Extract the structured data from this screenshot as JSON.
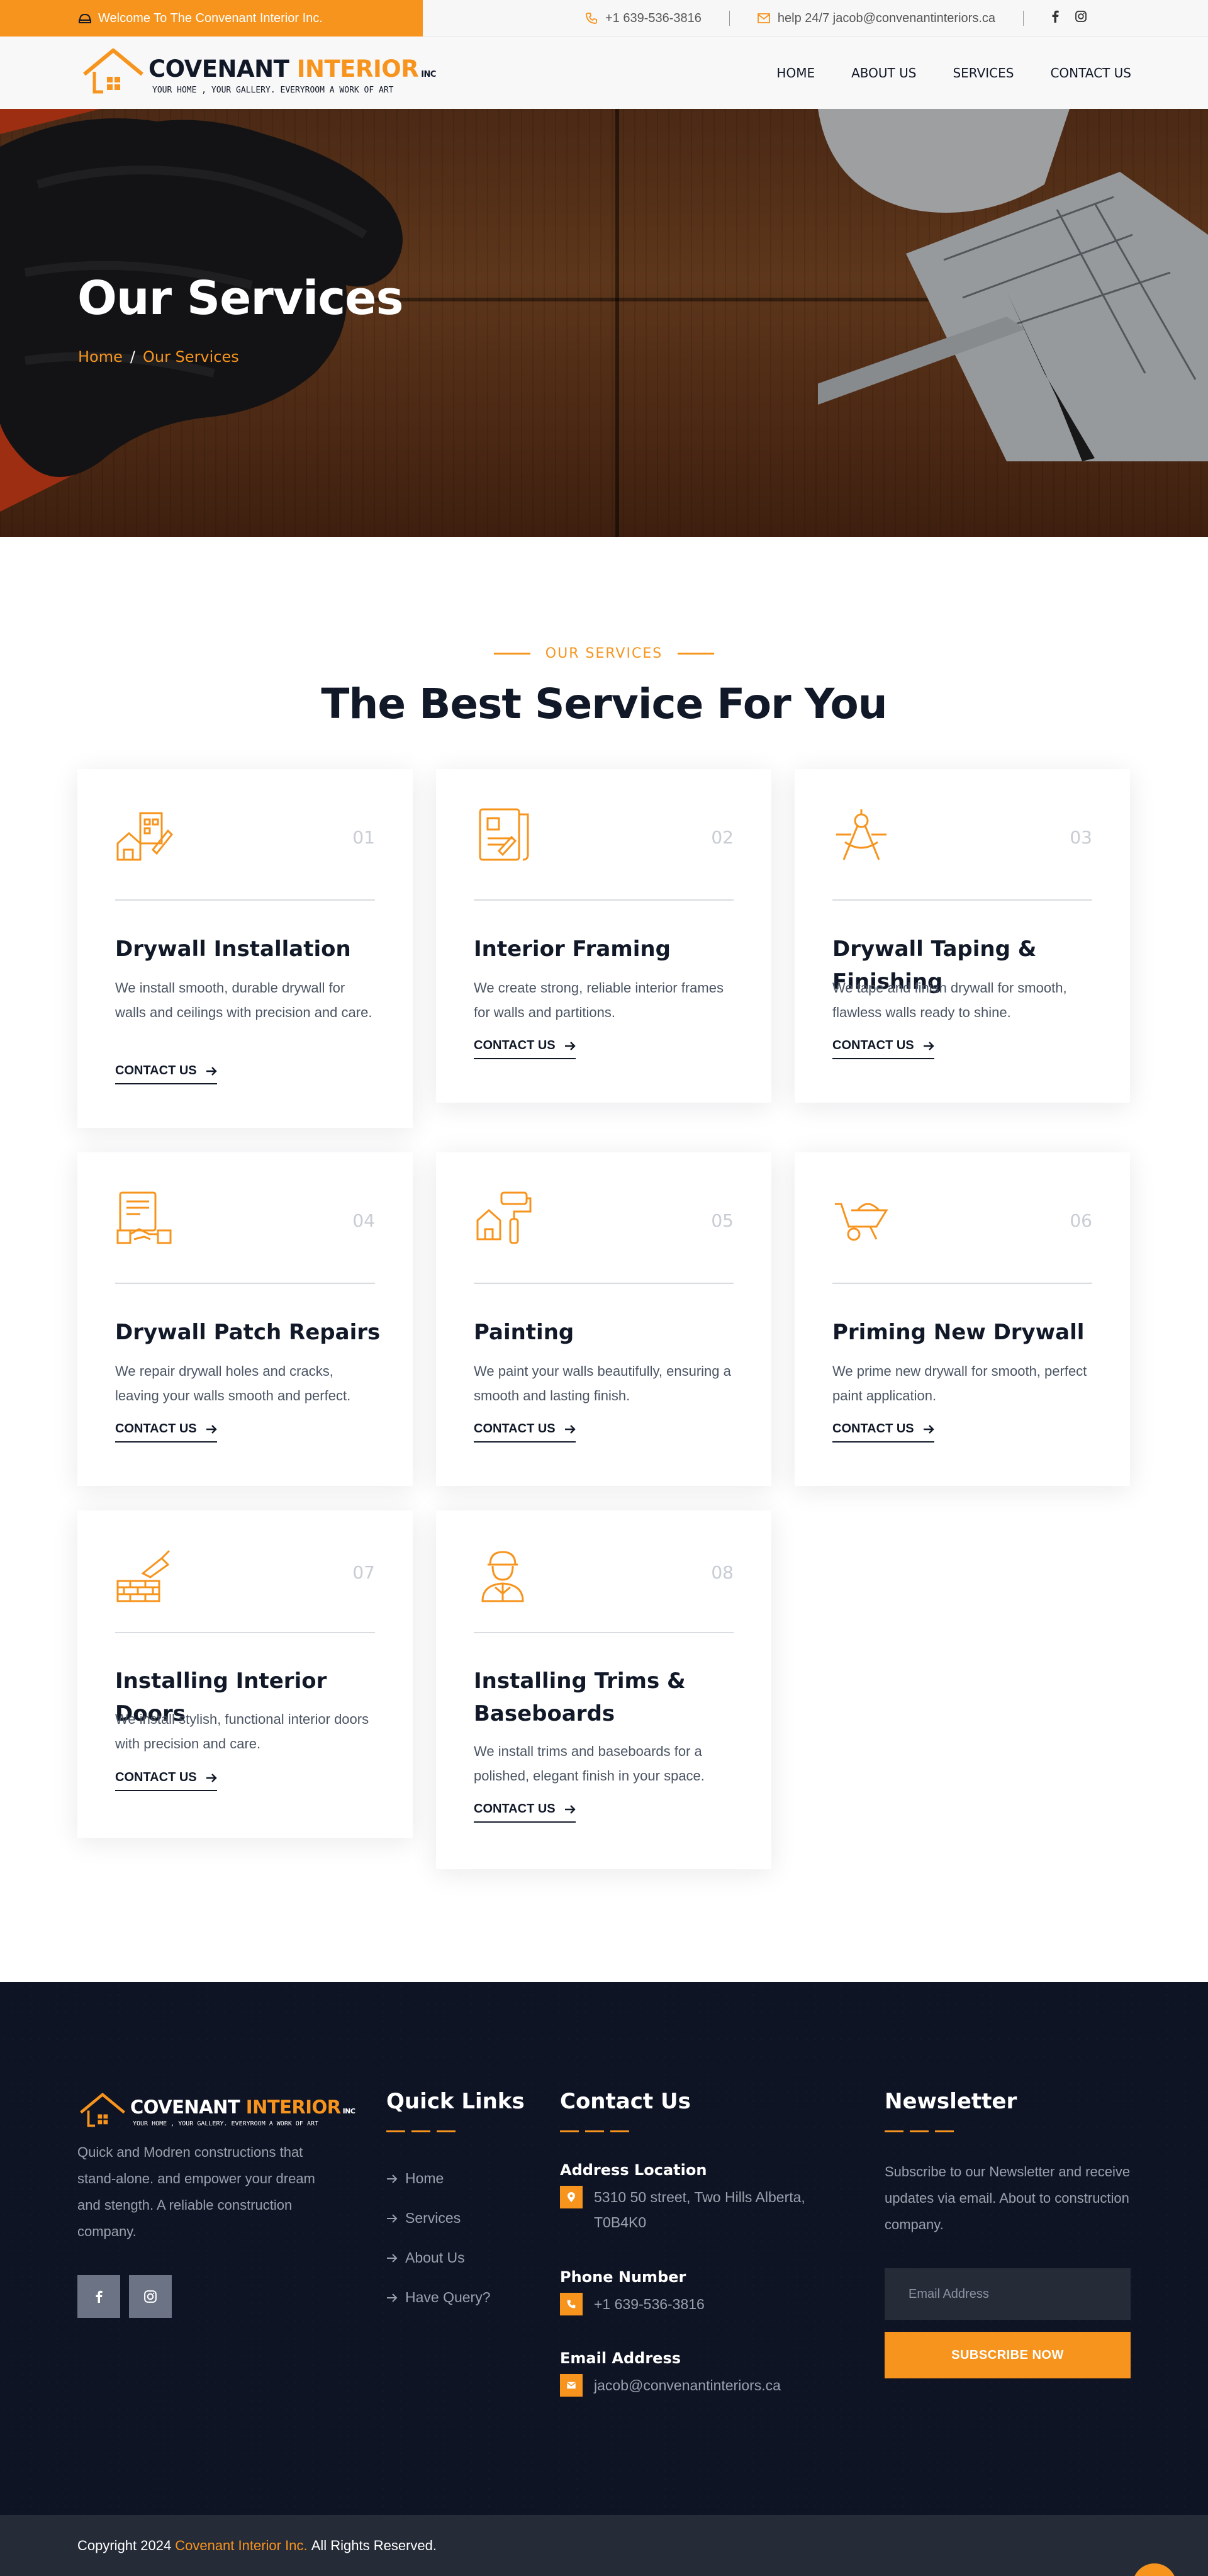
{
  "colors": {
    "accent": "#f7941d",
    "dark": "#111827",
    "footer_bg": "#0f1424",
    "copyright_bg": "#262b38"
  },
  "topbar": {
    "welcome": "Welcome To The Convenant Interior Inc.",
    "phone": "+1 639-536-3816",
    "email": "help 24/7 jacob@convenantinteriors.ca",
    "social_icons": [
      "facebook-icon",
      "instagram-icon"
    ]
  },
  "header": {
    "logo": {
      "name_part1": "COVENANT",
      "name_part2": "INTERIOR",
      "suffix": "INC",
      "tagline": "YOUR HOME , YOUR GALLERY. EVERYROOM A WORK OF ART"
    },
    "nav": [
      "HOME",
      "ABOUT US",
      "SERVICES",
      "CONTACT US"
    ]
  },
  "hero": {
    "title": "Our Services",
    "breadcrumb": {
      "home": "Home",
      "separator": "/",
      "current": "Our Services"
    }
  },
  "services": {
    "tagline": "OUR SERVICES",
    "heading": "The Best Service For You",
    "items": [
      {
        "number": "01",
        "icon": "blueprint-house-icon",
        "title": "Drywall Installation",
        "description": "We install smooth, durable drywall for walls and ceilings with precision and care.",
        "cta": "CONTACT US"
      },
      {
        "number": "02",
        "icon": "plans-drawing-icon",
        "title": "Interior Framing",
        "description": "We create strong, reliable interior frames for walls and partitions.",
        "cta": "CONTACT US"
      },
      {
        "number": "03",
        "icon": "compass-icon",
        "title": "Drywall Taping & Finishing",
        "description": "We tape and finish drywall for smooth, flawless walls ready to shine.",
        "cta": "CONTACT US"
      },
      {
        "number": "04",
        "icon": "contract-handshake-icon",
        "title": "Drywall Patch Repairs",
        "description": "We repair drywall holes and cracks, leaving your walls smooth and perfect.",
        "cta": "CONTACT US"
      },
      {
        "number": "05",
        "icon": "paint-roller-icon",
        "title": "Painting",
        "description": "We paint your walls beautifully, ensuring a smooth and lasting finish.",
        "cta": "CONTACT US"
      },
      {
        "number": "06",
        "icon": "wheelbarrow-icon",
        "title": "Priming New Drywall",
        "description": "We prime new drywall for smooth, perfect paint application.",
        "cta": "CONTACT US"
      },
      {
        "number": "07",
        "icon": "bricks-trowel-icon",
        "title": "Installing Interior Doors",
        "description": "We install stylish, functional interior doors with precision and care.",
        "cta": "CONTACT US"
      },
      {
        "number": "08",
        "icon": "worker-icon",
        "title": "Installing Trims & Baseboards",
        "description": "We install trims and baseboards for a polished, elegant finish in your space.",
        "cta": "CONTACT US"
      }
    ]
  },
  "footer": {
    "logo": {
      "name_part1": "COVENANT",
      "name_part2": "INTERIOR",
      "suffix": "INC",
      "tagline": "YOUR HOME , YOUR GALLERY. EVERYROOM A WORK OF ART"
    },
    "about": "Quick and Modren constructions that stand-alone. and empower your dream and stength. A reliable construction company.",
    "social_icons": [
      "facebook-icon",
      "instagram-icon"
    ],
    "quick_links": {
      "title": "Quick Links",
      "items": [
        "Home",
        "Services",
        "About Us",
        "Have Query?"
      ]
    },
    "contact": {
      "title": "Contact Us",
      "address_label": "Address Location",
      "address": "5310 50 street, Two Hills Alberta, T0B4K0",
      "phone_label": "Phone Number",
      "phone": "+1 639-536-3816",
      "email_label": "Email Address",
      "email": "jacob@convenantinteriors.ca"
    },
    "newsletter": {
      "title": "Newsletter",
      "text": "Subscribe to our Newsletter and receive updates via email. About to construction company.",
      "placeholder": "Email Address",
      "button": "SUBSCRIBE NOW"
    }
  },
  "copyright": {
    "prefix": "Copyright 2024",
    "brand": "Covenant Interior Inc.",
    "suffix": "All Rights Reserved."
  }
}
